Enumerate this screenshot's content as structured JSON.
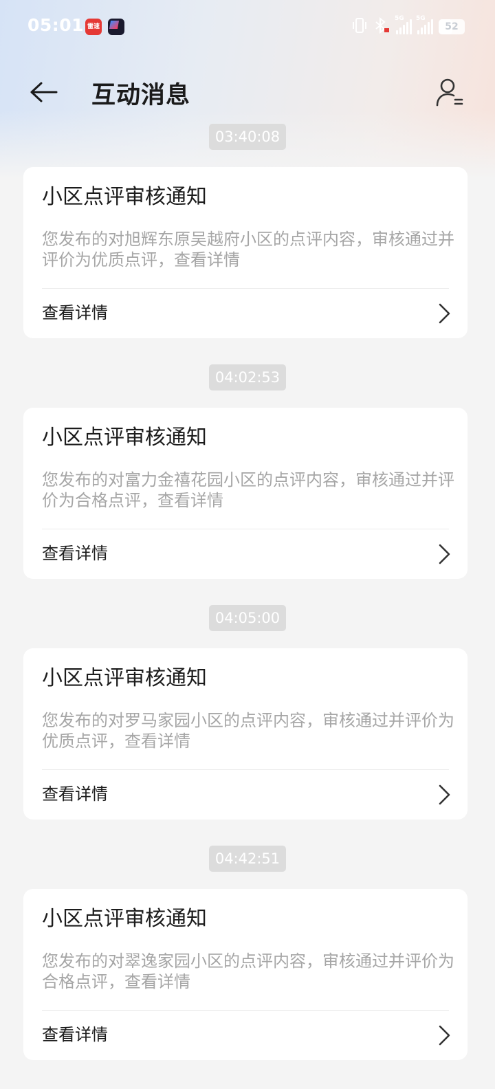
{
  "status_bar": {
    "time": "05:01",
    "app_icons": [
      {
        "name": "雷速",
        "color": "#e53935"
      },
      {
        "name": "app-icon",
        "color": "#1a1a2e"
      }
    ],
    "network_1": "5G",
    "network_2": "5G",
    "battery": "52",
    "battery_level": 0.52
  },
  "header": {
    "title": "互动消息"
  },
  "messages": [
    {
      "timestamp": "03:40:08",
      "title": "小区点评审核通知",
      "body": "您发布的对旭辉东原吴越府小区的点评内容，审核通过并评价为优质点评，查看详情",
      "action": "查看详情"
    },
    {
      "timestamp": "04:02:53",
      "title": "小区点评审核通知",
      "body": "您发布的对富力金禧花园小区的点评内容，审核通过并评价为合格点评，查看详情",
      "action": "查看详情"
    },
    {
      "timestamp": "04:05:00",
      "title": "小区点评审核通知",
      "body": "您发布的对罗马家园小区的点评内容，审核通过并评价为优质点评，查看详情",
      "action": "查看详情"
    },
    {
      "timestamp": "04:42:51",
      "title": "小区点评审核通知",
      "body": "您发布的对翠逸家园小区的点评内容，审核通过并评价为合格点评，查看详情",
      "action": "查看详情"
    }
  ],
  "colors": {
    "title_text": "#1c1c1c",
    "body_text": "#a6a6a6",
    "timestamp_bg": "#dcdcdc",
    "page_bg": "#f4f4f4"
  }
}
